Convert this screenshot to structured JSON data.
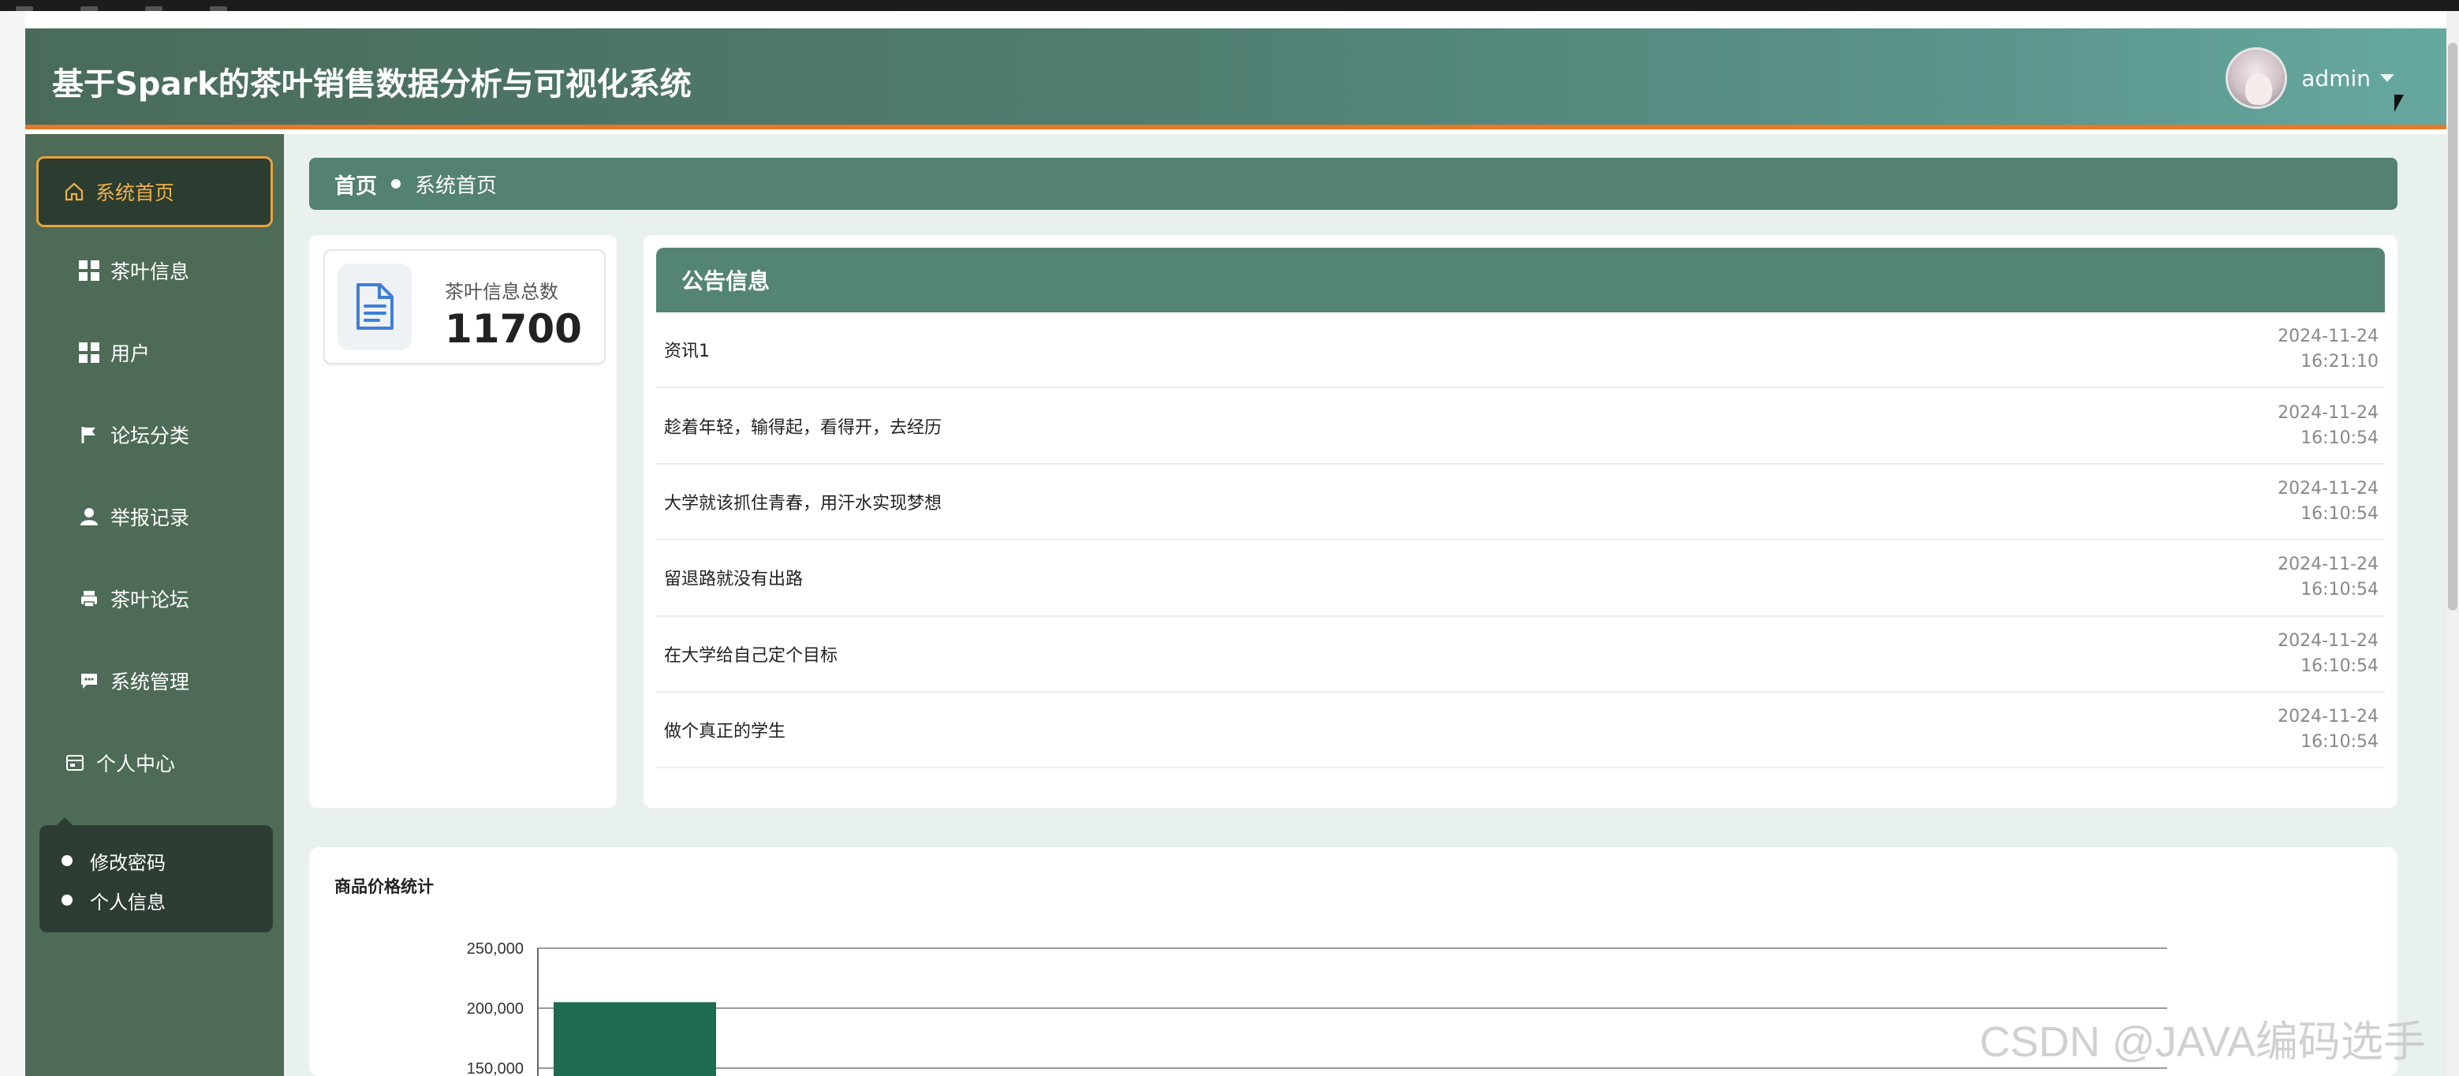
{
  "header": {
    "title": "基于Spark的茶叶销售数据分析与可视化系统",
    "user_name": "admin"
  },
  "sidebar": {
    "items": [
      {
        "label": "系统首页",
        "icon": "home-icon",
        "active": true
      },
      {
        "label": "茶叶信息",
        "icon": "grid-icon"
      },
      {
        "label": "用户",
        "icon": "grid-icon"
      },
      {
        "label": "论坛分类",
        "icon": "flag-icon"
      },
      {
        "label": "举报记录",
        "icon": "user-icon"
      },
      {
        "label": "茶叶论坛",
        "icon": "print-icon"
      },
      {
        "label": "系统管理",
        "icon": "chat-icon"
      },
      {
        "label": "个人中心",
        "icon": "card-icon"
      }
    ],
    "submenu": [
      {
        "label": "修改密码"
      },
      {
        "label": "个人信息"
      }
    ]
  },
  "breadcrumb": {
    "home": "首页",
    "current": "系统首页"
  },
  "stat": {
    "label": "茶叶信息总数",
    "value": "11700",
    "icon": "document-icon"
  },
  "notices": {
    "title": "公告信息",
    "items": [
      {
        "title": "资讯1",
        "date": "2024-11-24",
        "time": "16:21:10"
      },
      {
        "title": "趁着年轻，输得起，看得开，去经历",
        "date": "2024-11-24",
        "time": "16:10:54"
      },
      {
        "title": "大学就该抓住青春，用汗水实现梦想",
        "date": "2024-11-24",
        "time": "16:10:54"
      },
      {
        "title": "留退路就没有出路",
        "date": "2024-11-24",
        "time": "16:10:54"
      },
      {
        "title": "在大学给自己定个目标",
        "date": "2024-11-24",
        "time": "16:10:54"
      },
      {
        "title": "做个真正的学生",
        "date": "2024-11-24",
        "time": "16:10:54"
      }
    ]
  },
  "chart_data": {
    "type": "bar",
    "title": "商品价格统计",
    "y_ticks": [
      "250,000",
      "200,000",
      "150,000"
    ],
    "y_tick_values": [
      250000,
      200000,
      150000
    ],
    "ylim": [
      150000,
      250000
    ],
    "grid": true,
    "bar_color": "#1f6b52",
    "values": [
      205000
    ]
  },
  "watermark": "CSDN @JAVA编码选手",
  "colors": {
    "header_accent": "#e07a2c",
    "sidebar_bg": "#4d6b56",
    "active_border": "#e8a33c",
    "panel_head": "#548472"
  }
}
